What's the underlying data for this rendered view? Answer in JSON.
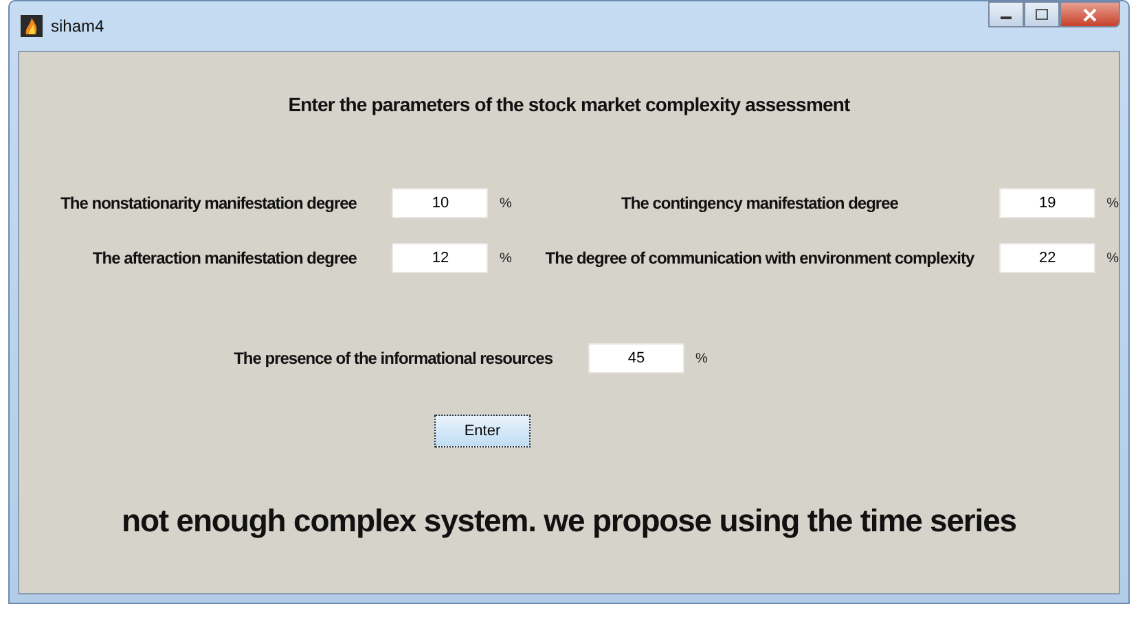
{
  "window": {
    "title": "siham4"
  },
  "heading": "Enter the parameters of the stock market complexity assessment",
  "rows": [
    [
      {
        "label": "The nonstationarity manifestation degree",
        "value": "10",
        "unit": "%"
      },
      {
        "label": "The contingency manifestation degree",
        "value": "19",
        "unit": "%"
      }
    ],
    [
      {
        "label": "The afteraction manifestation degree",
        "value": "12",
        "unit": "%"
      },
      {
        "label": "The degree of communication with environment complexity",
        "value": "22",
        "unit": "%"
      }
    ]
  ],
  "single": {
    "label": "The presence of the informational resources",
    "value": "45",
    "unit": "%"
  },
  "button": "Enter",
  "result": "not enough complex system. we propose using the time series"
}
